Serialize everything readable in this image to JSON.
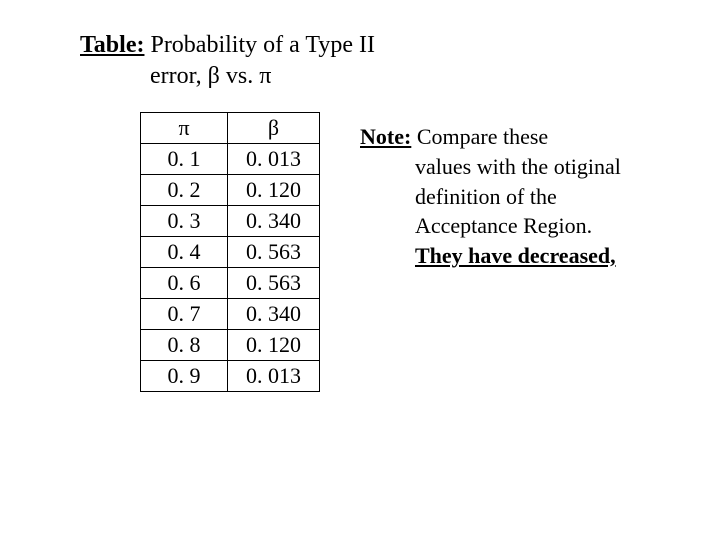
{
  "title": {
    "label": "Table:",
    "line1_text": " Probability of a Type II",
    "line2_text_a": "error, ",
    "beta": "β",
    "vs": " vs. ",
    "pi": "π"
  },
  "chart_data": {
    "type": "table",
    "headers": [
      "π",
      "β"
    ],
    "rows": [
      [
        "0. 1",
        "0. 013"
      ],
      [
        "0. 2",
        "0. 120"
      ],
      [
        "0. 3",
        "0. 340"
      ],
      [
        "0. 4",
        "0. 563"
      ],
      [
        "0. 6",
        "0. 563"
      ],
      [
        "0. 7",
        "0. 340"
      ],
      [
        "0. 8",
        "0. 120"
      ],
      [
        "0. 9",
        "0. 013"
      ]
    ]
  },
  "note": {
    "label": "Note:",
    "body_a": " Compare these",
    "body_b": "values with the otiginal definition of the Acceptance Region. ",
    "emph": "They have decreased,"
  }
}
